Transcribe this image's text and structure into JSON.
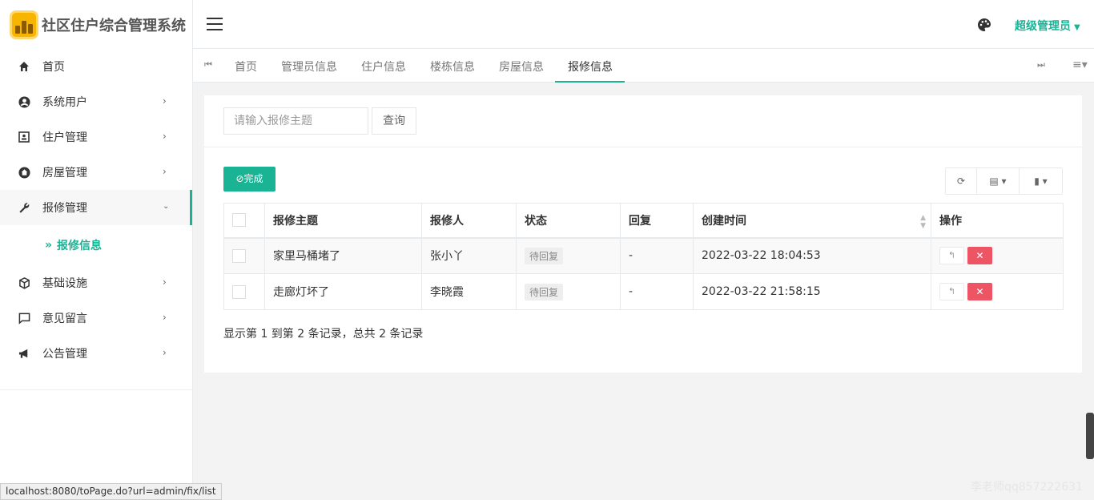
{
  "app": {
    "title": "社区住户综合管理系统"
  },
  "header": {
    "user": "超级管理员"
  },
  "sidebar": {
    "items": [
      {
        "label": "首页",
        "icon": "home-icon"
      },
      {
        "label": "系统用户",
        "icon": "user-circle-icon"
      },
      {
        "label": "住户管理",
        "icon": "id-card-icon"
      },
      {
        "label": "房屋管理",
        "icon": "house-icon"
      },
      {
        "label": "报修管理",
        "icon": "wrench-icon"
      },
      {
        "label": "基础设施",
        "icon": "cube-icon"
      },
      {
        "label": "意见留言",
        "icon": "comment-icon"
      },
      {
        "label": "公告管理",
        "icon": "bullhorn-icon"
      }
    ],
    "sub": {
      "label": "报修信息"
    }
  },
  "tabs": [
    "首页",
    "管理员信息",
    "住户信息",
    "楼栋信息",
    "房屋信息",
    "报修信息"
  ],
  "search": {
    "placeholder": "请输入报修主题",
    "button": "查询"
  },
  "toolbar": {
    "done": "完成"
  },
  "table": {
    "headers": [
      "报修主题",
      "报修人",
      "状态",
      "回复",
      "创建时间",
      "操作"
    ],
    "rows": [
      {
        "subject": "家里马桶堵了",
        "person": "张小丫",
        "status": "待回复",
        "reply": "-",
        "time": "2022-03-22 18:04:53"
      },
      {
        "subject": "走廊灯坏了",
        "person": "李晓霞",
        "status": "待回复",
        "reply": "-",
        "time": "2022-03-22 21:58:15"
      }
    ]
  },
  "pager": "显示第 1 到第 2 条记录，总共 2 条记录",
  "status_url": "localhost:8080/toPage.do?url=admin/fix/list",
  "watermark": "李老师qq857222631",
  "colors": {
    "accent": "#1ab394",
    "danger": "#ed5565"
  }
}
